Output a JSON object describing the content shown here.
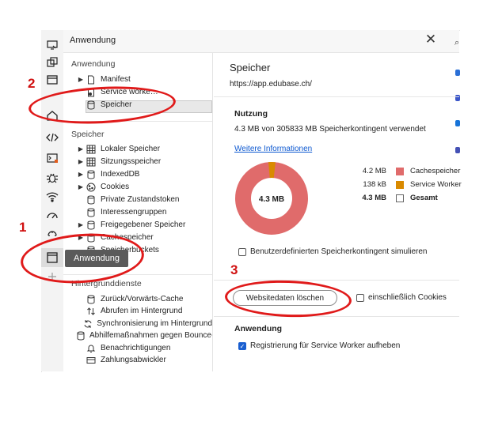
{
  "window": {
    "title": "Anwendung",
    "close_glyph": "✕"
  },
  "sidebar": {
    "section1": "Anwendung",
    "app_items": [
      {
        "label": "Manifest",
        "icon": "file-icon",
        "arrow": "▶"
      },
      {
        "label": "Service worke…",
        "icon": "gear-file-icon",
        "arrow": ""
      },
      {
        "label": "Speicher",
        "icon": "database-icon",
        "arrow": ""
      }
    ],
    "section2": "Speicher",
    "storage_items": [
      {
        "label": "Lokaler Speicher",
        "icon": "grid-icon",
        "arrow": "▶"
      },
      {
        "label": "Sitzungsspeicher",
        "icon": "grid-icon",
        "arrow": "▶"
      },
      {
        "label": "IndexedDB",
        "icon": "database-icon",
        "arrow": "▶"
      },
      {
        "label": "Cookies",
        "icon": "cookie-icon",
        "arrow": "▶"
      },
      {
        "label": "Private Zustandstoken",
        "icon": "database-icon",
        "arrow": ""
      },
      {
        "label": "Interessengruppen",
        "icon": "database-icon",
        "arrow": ""
      },
      {
        "label": "Freigegebener Speicher",
        "icon": "database-icon",
        "arrow": "▶"
      },
      {
        "label": "Cachespeicher",
        "icon": "database-icon",
        "arrow": "▶"
      },
      {
        "label": "Speicherbuckets",
        "icon": "database-icon",
        "arrow": ""
      }
    ],
    "section3": "Hintergrunddienste",
    "bg_items": [
      {
        "label": "Zurück/Vorwärts-Cache",
        "icon": "database-icon"
      },
      {
        "label": "Abrufen im Hintergrund",
        "icon": "updown-icon"
      },
      {
        "label": "Synchronisierung im Hintergrund",
        "icon": "sync-icon"
      },
      {
        "label": "Abhilfemaßnahmen gegen Bounce-Tracking",
        "icon": "database-icon"
      },
      {
        "label": "Benachrichtigungen",
        "icon": "bell-icon"
      },
      {
        "label": "Zahlungsabwickler",
        "icon": "card-icon"
      }
    ]
  },
  "main": {
    "title": "Speicher",
    "url": "https://app.edubase.ch/",
    "usage_heading": "Nutzung",
    "quota_text": "4.3 MB von 305833 MB Speicherkontingent verwendet",
    "more_info": "Weitere Informationen",
    "donut_label": "4.3 MB",
    "legend": [
      {
        "value": "4.2 MB",
        "name": "Cachespeicher",
        "color": "#e06b6b"
      },
      {
        "value": "138 kB",
        "name": "Service Worker",
        "color": "#d98a00"
      },
      {
        "value": "4.3 MB",
        "name": "Gesamt",
        "color": "#ffffff",
        "bold": true
      }
    ],
    "custom_quota_label": "Benutzerdefinierten Speicherkontingent simulieren",
    "clear_button": "Websitedaten löschen",
    "include_cookies": "einschließlich Cookies",
    "app_heading": "Anwendung",
    "unregister_sw": "Registrierung für Service Worker aufheben",
    "unregister_checked": true
  },
  "tooltip": "Anwendung",
  "annotations": {
    "n1": "1",
    "n2": "2",
    "n3": "3"
  },
  "colors": {
    "accent": "#0b57d0",
    "annotation_red": "#e01a1a",
    "cache": "#e06b6b",
    "service_worker": "#d98a00"
  }
}
